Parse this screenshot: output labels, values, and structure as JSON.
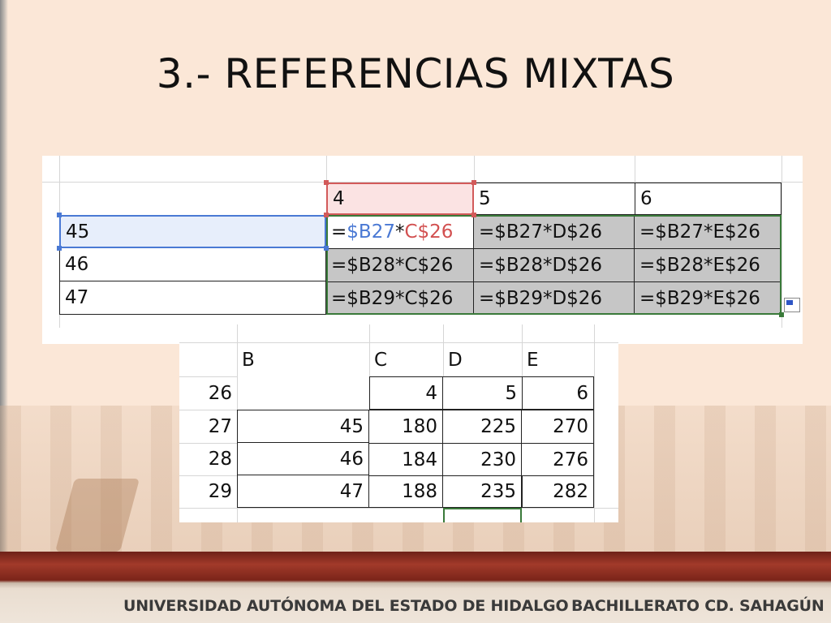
{
  "slide": {
    "title": "3.- REFERENCIAS MIXTAS"
  },
  "formula_grid": {
    "header_values": [
      "4",
      "5",
      "6"
    ],
    "row_values": [
      "45",
      "46",
      "47"
    ],
    "formulas": [
      [
        "=$B27*C$26",
        "=$B27*D$26",
        "=$B27*E$26"
      ],
      [
        "=$B28*C$26",
        "=$B28*D$26",
        "=$B28*E$26"
      ],
      [
        "=$B29*C$26",
        "=$B29*D$26",
        "=$B29*E$26"
      ]
    ],
    "active_formula_parts": {
      "eq": "=",
      "ref_row": "$B27",
      "op": "*",
      "ref_col": "C$26"
    },
    "colors": {
      "ref_row": "#4a79d4",
      "ref_col": "#d25050",
      "fill_range": "#3a7a3a"
    }
  },
  "result_grid": {
    "column_headers": [
      "B",
      "C",
      "D",
      "E"
    ],
    "row_headers": [
      "26",
      "27",
      "28",
      "29"
    ],
    "top_row": [
      "4",
      "5",
      "6"
    ],
    "rows": [
      {
        "b": "45",
        "values": [
          "180",
          "225",
          "270"
        ]
      },
      {
        "b": "46",
        "values": [
          "184",
          "230",
          "276"
        ]
      },
      {
        "b": "47",
        "values": [
          "188",
          "235",
          "282"
        ]
      }
    ]
  },
  "footer": {
    "left": "UNIVERSIDAD AUTÓNOMA DEL ESTADO DE HIDALGO",
    "right": "BACHILLERATO CD. SAHAGÚN"
  }
}
